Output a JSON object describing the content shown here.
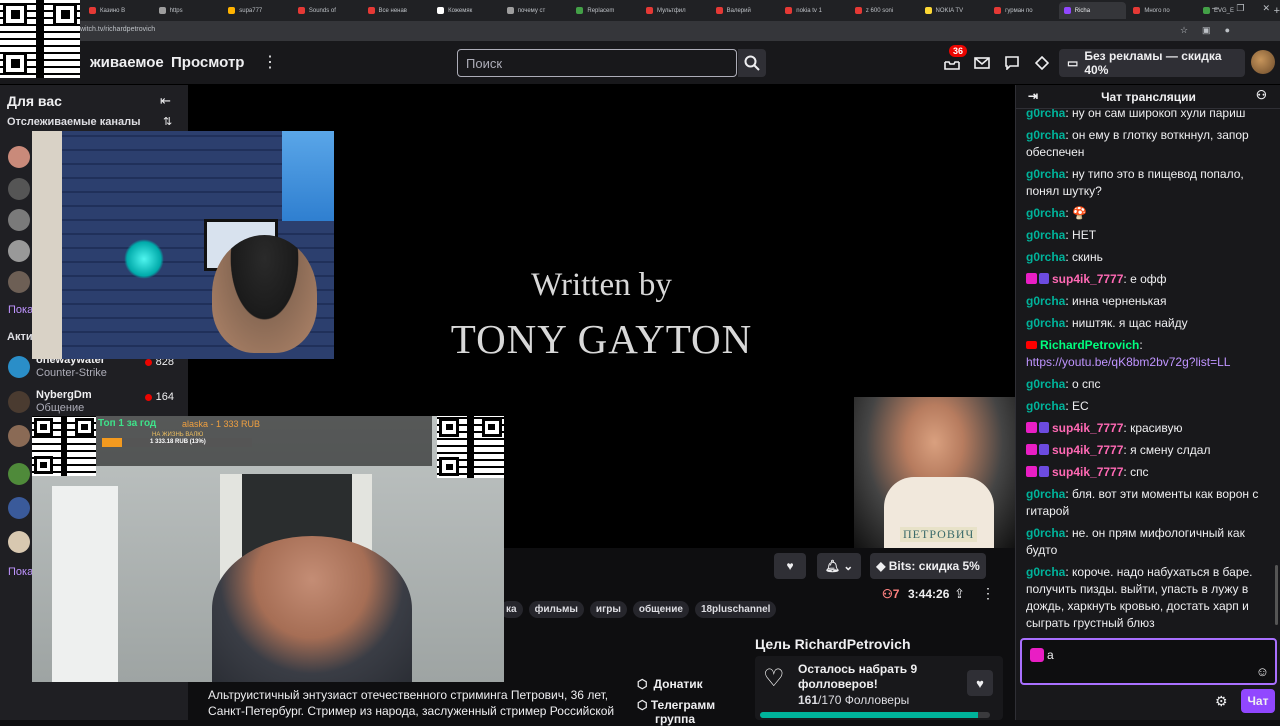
{
  "browser": {
    "tabs": [
      {
        "label": "Казино В",
        "color": "#e53935"
      },
      {
        "label": "https",
        "color": "#9e9e9e"
      },
      {
        "label": "supa777",
        "color": "#ffb300"
      },
      {
        "label": "Sounds of",
        "color": "#e53935"
      },
      {
        "label": "Все ненав",
        "color": "#e53935"
      },
      {
        "label": "Кожемяк",
        "color": "#ffffff"
      },
      {
        "label": "почему ст",
        "color": "#9e9e9e"
      },
      {
        "label": "Replacem",
        "color": "#43a047"
      },
      {
        "label": "Мультфил",
        "color": "#e53935"
      },
      {
        "label": "Валерий",
        "color": "#e53935"
      },
      {
        "label": "nokia tv 1",
        "color": "#e53935"
      },
      {
        "label": "z 600 soni",
        "color": "#e53935"
      },
      {
        "label": "NOKIA TV",
        "color": "#fdd835"
      },
      {
        "label": "гурман по",
        "color": "#e53935"
      },
      {
        "label": "Richa",
        "color": "#9147ff",
        "active": true
      },
      {
        "label": "Много по",
        "color": "#e53935"
      },
      {
        "label": "EVG_E",
        "color": "#43a047"
      }
    ],
    "new_tab": "+",
    "url": "witch.tv/richardpetrovich"
  },
  "nav": {
    "following": "живаемое",
    "browse": "Просмотр",
    "search_placeholder": "Поиск",
    "notif_count": "36",
    "prime_label": "Без рекламы — скидка 40%"
  },
  "sidebar": {
    "title": "Для вас",
    "followed_title": "Отслеживаемые каналы",
    "more_1": "Пока",
    "live_title": "Акти",
    "more_2": "Пока",
    "channels": [
      {
        "name": "onewaywater",
        "game": "Counter-Strike",
        "viewers": "828"
      },
      {
        "name": "NybergDm",
        "game": "Общение",
        "viewers": "164"
      }
    ]
  },
  "player": {
    "credit_line1": "Written by",
    "credit_line2": "TONY GAYTON",
    "name_plate": "ПЕТРОВИЧ"
  },
  "overlay": {
    "top_label": "Топ 1 за год",
    "top_name": "alaska - 1 333 RUB",
    "sub_label": "НА ЖИЗНЬ ВАЛЮ",
    "progress_text": "1 333.18 RUB (13%)",
    "progress": 0.13
  },
  "stream": {
    "bits_label": "Bits: скидка 5%",
    "viewers": "7",
    "uptime": "3:44:26",
    "tags": [
      "ка",
      "фильмы",
      "игры",
      "общение",
      "18pluschannel"
    ],
    "about": "Альтруистичный энтузиаст отечественного стриминга Петрович, 36 лет, Санкт-Петербург. Стример из народа, заслуженный стример Российской",
    "panel_1": "Донатик",
    "panel_2": "Телеграмм",
    "panel_2b": "группа",
    "goal_title": "Цель RichardPetrovich",
    "goal_text": "Осталось набрать 9 фолловеров!",
    "goal_count": "161",
    "goal_total": "/170 Фолловеры",
    "goal_progress": 0.947
  },
  "chat": {
    "title": "Чат трансляции",
    "input_value": "а",
    "send_label": "Чат",
    "messages": [
      {
        "user": "g0rcha",
        "color": "#00b39b",
        "text": "ну он сам широкоп хули париш"
      },
      {
        "user": "g0rcha",
        "color": "#00b39b",
        "text": "он ему в глотку воткннул, запор обеспечен"
      },
      {
        "user": "g0rcha",
        "color": "#00b39b",
        "text": "ну типо это в пищевод попало, понял шутку?"
      },
      {
        "user": "g0rcha",
        "color": "#00b39b",
        "text": "🍄"
      },
      {
        "user": "g0rcha",
        "color": "#00b39b",
        "text": "НЕТ"
      },
      {
        "user": "g0rcha",
        "color": "#00b39b",
        "text": "скинь"
      },
      {
        "user": "sup4ik_7777",
        "color": "#ff69b4",
        "text": "е офф",
        "badges": true
      },
      {
        "user": "g0rcha",
        "color": "#00b39b",
        "text": "инна черненькая"
      },
      {
        "user": "g0rcha",
        "color": "#00b39b",
        "text": "ништяк. я щас найду"
      },
      {
        "user": "RichardPetrovich",
        "color": "#00ff7f",
        "text": "",
        "link": "https://youtu.be/qK8bm2bv72g?list=LL",
        "yt": true
      },
      {
        "user": "g0rcha",
        "color": "#00b39b",
        "text": "о спс"
      },
      {
        "user": "g0rcha",
        "color": "#00b39b",
        "text": "ЕС"
      },
      {
        "user": "sup4ik_7777",
        "color": "#ff69b4",
        "text": "красивую",
        "badges": true
      },
      {
        "user": "sup4ik_7777",
        "color": "#ff69b4",
        "text": "я смену слдал",
        "badges": true
      },
      {
        "user": "sup4ik_7777",
        "color": "#ff69b4",
        "text": "спс",
        "badges": true
      },
      {
        "user": "g0rcha",
        "color": "#00b39b",
        "text": "бля. вот эти моменты как ворон с гитарой"
      },
      {
        "user": "g0rcha",
        "color": "#00b39b",
        "text": "не. он прям мифологичный как будто"
      },
      {
        "user": "g0rcha",
        "color": "#00b39b",
        "text": "короче. надо набухаться в баре. получить пизды. выйти, упасть в лужу в дождь, харкнуть кровью, достать харп и сыграть грустный блюз"
      }
    ]
  }
}
